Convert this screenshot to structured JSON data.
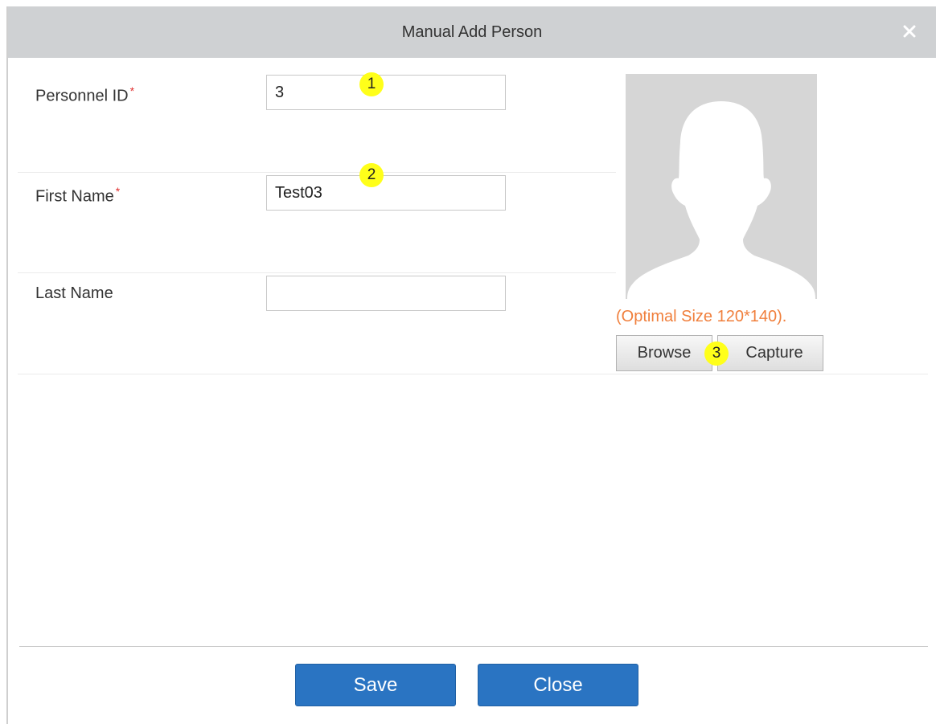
{
  "dialog": {
    "title": "Manual Add Person",
    "close_icon": "close-icon"
  },
  "form": {
    "personnel_id": {
      "label": "Personnel ID",
      "required_mark": "*",
      "value": "3"
    },
    "first_name": {
      "label": "First Name",
      "required_mark": "*",
      "value": "Test03"
    },
    "last_name": {
      "label": "Last Name",
      "value": ""
    }
  },
  "photo": {
    "placeholder_icon": "person-silhouette-icon",
    "hint": "(Optimal Size 120*140).",
    "browse_label": "Browse",
    "capture_label": "Capture"
  },
  "markers": [
    "1",
    "2",
    "3"
  ],
  "footer": {
    "save_label": "Save",
    "close_label": "Close"
  },
  "colors": {
    "accent": "#2a74c2",
    "required": "#e03030",
    "hint": "#f07f3c",
    "marker": "#ffff1a",
    "titlebar": "#cfd1d3"
  }
}
